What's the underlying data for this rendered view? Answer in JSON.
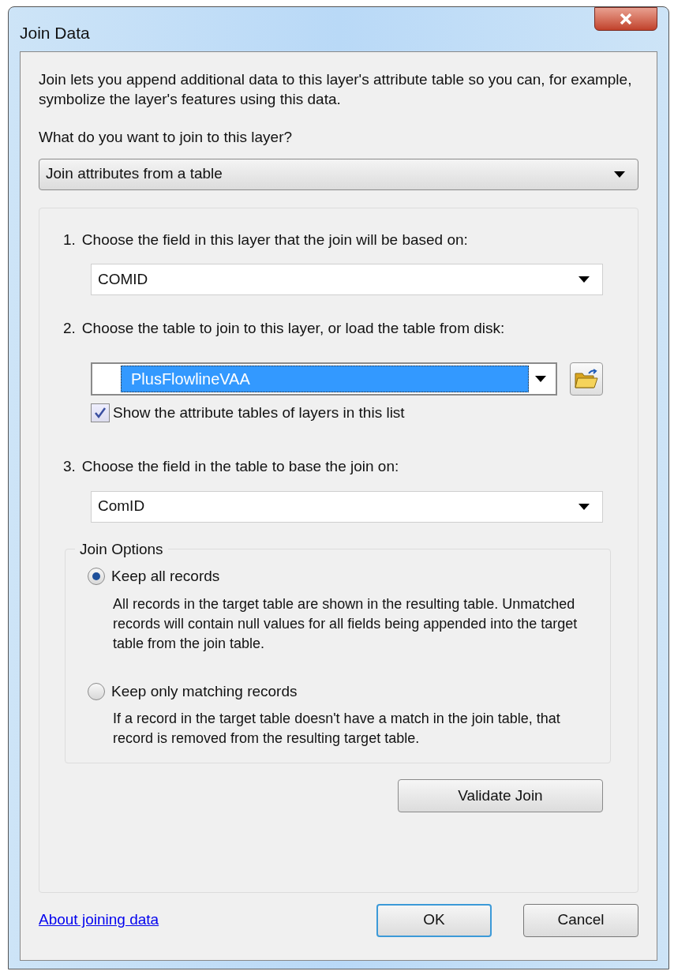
{
  "window": {
    "title": "Join Data"
  },
  "intro": "Join lets you append additional data to this layer's attribute table so you can, for example, symbolize the layer's features using this data.",
  "question": "What do you want to join to this layer?",
  "join_type": {
    "value": "Join attributes from a table"
  },
  "steps": [
    {
      "number": "1.",
      "label": "Choose the field in this layer that the join will be based on:",
      "field": {
        "value": "COMID",
        "focused": false
      }
    },
    {
      "number": "2.",
      "label": "Choose the table to join to this layer, or load the table from disk:",
      "field": {
        "value": "PlusFlowlineVAA",
        "focused": true
      },
      "checkbox": {
        "label": "Show the attribute tables of layers in this list",
        "checked": true
      }
    },
    {
      "number": "3.",
      "label": "Choose the field in the table to base the join on:",
      "field": {
        "value": "ComID",
        "focused": false
      }
    }
  ],
  "join_options": {
    "title": "Join Options",
    "options": [
      {
        "label": "Keep all records",
        "selected": true,
        "description": "All records in the target table are shown in the resulting table. Unmatched records will contain null values for all fields being appended into the target table from the join table."
      },
      {
        "label": "Keep only matching records",
        "selected": false,
        "description": "If a record in the target table doesn't have a match in the join table, that record is removed from the resulting target table."
      }
    ]
  },
  "validate_button": "Validate Join",
  "help_link": "About joining data",
  "buttons": [
    {
      "label": "OK",
      "default": true
    },
    {
      "label": "Cancel",
      "default": false
    }
  ]
}
